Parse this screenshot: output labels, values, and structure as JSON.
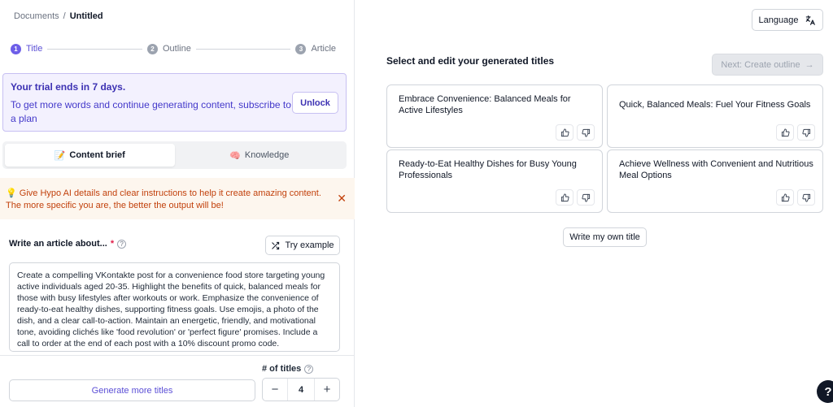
{
  "breadcrumb": {
    "root": "Documents",
    "separator": "/",
    "current": "Untitled"
  },
  "stepper": {
    "steps": [
      {
        "num": "1",
        "label": "Title"
      },
      {
        "num": "2",
        "label": "Outline"
      },
      {
        "num": "3",
        "label": "Article"
      }
    ],
    "active_index": 0
  },
  "trial": {
    "title": "Your trial ends in 7 days.",
    "message": "To get more words and continue generating content, subscribe to a plan",
    "unlock_label": "Unlock"
  },
  "tabs": [
    {
      "label": "Content brief",
      "icon": "📝"
    },
    {
      "label": "Knowledge",
      "icon": "🧠"
    }
  ],
  "hint": {
    "icon": "💡",
    "text": "Give Hypo AI details and clear instructions to help it create amazing content. The more specific you are, the better the output will be!"
  },
  "article_field": {
    "label": "Write an article about...",
    "required_mark": "*",
    "try_example_label": "Try example",
    "value": "Create a compelling VKontakte post for a convenience food store targeting young active individuals aged 20-35. Highlight the benefits of quick, balanced meals for those with busy lifestyles after workouts or work. Emphasize the convenience of ready-to-eat healthy dishes, supporting fitness goals. Use emojis, a photo of the dish, and a clear call-to-action. Maintain an energetic, friendly, and motivational tone, avoiding clichés like 'food revolution' or 'perfect figure' promises. Include a call to order at the end of each post with a 10% discount promo code."
  },
  "bottom": {
    "generate_label": "Generate more titles",
    "titles_count_label": "# of titles",
    "titles_count": "4",
    "minus": "−",
    "plus": "+"
  },
  "right": {
    "language_label": "Language",
    "section_title": "Select and edit your generated titles",
    "next_label": "Next: Create outline",
    "titles": [
      "Embrace Convenience: Balanced Meals for Active Lifestyles",
      "Quick, Balanced Meals: Fuel Your Fitness Goals",
      "Ready-to-Eat Healthy Dishes for Busy Young Professionals",
      "Achieve Wellness with Convenient and Nutritious Meal Options"
    ],
    "own_title_label": "Write my own title"
  },
  "help_fab": "?",
  "colors": {
    "accent": "#6d5ee8",
    "trial_bg": "#f3f1fe",
    "hint_text": "#c2410c",
    "hint_bg": "#fdf6ee"
  }
}
